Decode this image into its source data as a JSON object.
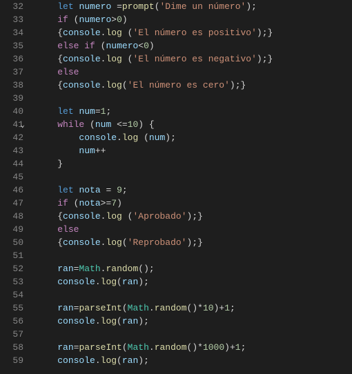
{
  "lines": [
    {
      "num": "32",
      "tokens": [
        [
          "    ",
          ""
        ],
        [
          "let",
          "kw"
        ],
        [
          " ",
          ""
        ],
        [
          "numero",
          "var"
        ],
        [
          " ",
          ""
        ],
        [
          "=",
          "op"
        ],
        [
          "prompt",
          "fn"
        ],
        [
          "(",
          "pun"
        ],
        [
          "'Dime un número'",
          "str"
        ],
        [
          ")",
          "pun"
        ],
        [
          ";",
          "pun"
        ]
      ]
    },
    {
      "num": "33",
      "tokens": [
        [
          "    ",
          ""
        ],
        [
          "if",
          "kw2"
        ],
        [
          " ",
          ""
        ],
        [
          "(",
          "pun"
        ],
        [
          "numero",
          "var"
        ],
        [
          ">",
          "op"
        ],
        [
          "0",
          "num"
        ],
        [
          ")",
          "pun"
        ]
      ]
    },
    {
      "num": "34",
      "tokens": [
        [
          "    ",
          ""
        ],
        [
          "{",
          "pun"
        ],
        [
          "console",
          "var"
        ],
        [
          ".",
          "pun"
        ],
        [
          "log",
          "fn"
        ],
        [
          " ",
          ""
        ],
        [
          "(",
          "pun"
        ],
        [
          "'El número es positivo'",
          "str"
        ],
        [
          ")",
          "pun"
        ],
        [
          ";",
          "pun"
        ],
        [
          "}",
          "pun"
        ]
      ]
    },
    {
      "num": "35",
      "tokens": [
        [
          "    ",
          ""
        ],
        [
          "else",
          "kw2"
        ],
        [
          " ",
          ""
        ],
        [
          "if",
          "kw2"
        ],
        [
          " ",
          ""
        ],
        [
          "(",
          "pun"
        ],
        [
          "numero",
          "var"
        ],
        [
          "<",
          "op"
        ],
        [
          "0",
          "num"
        ],
        [
          ")",
          "pun"
        ]
      ]
    },
    {
      "num": "36",
      "tokens": [
        [
          "    ",
          ""
        ],
        [
          "{",
          "pun"
        ],
        [
          "console",
          "var"
        ],
        [
          ".",
          "pun"
        ],
        [
          "log",
          "fn"
        ],
        [
          " ",
          ""
        ],
        [
          "(",
          "pun"
        ],
        [
          "'El número es negativo'",
          "str"
        ],
        [
          ")",
          "pun"
        ],
        [
          ";",
          "pun"
        ],
        [
          "}",
          "pun"
        ]
      ]
    },
    {
      "num": "37",
      "tokens": [
        [
          "    ",
          ""
        ],
        [
          "else",
          "kw2"
        ]
      ]
    },
    {
      "num": "38",
      "tokens": [
        [
          "    ",
          ""
        ],
        [
          "{",
          "pun"
        ],
        [
          "console",
          "var"
        ],
        [
          ".",
          "pun"
        ],
        [
          "log",
          "fn"
        ],
        [
          "(",
          "pun"
        ],
        [
          "'El número es cero'",
          "str"
        ],
        [
          ")",
          "pun"
        ],
        [
          ";",
          "pun"
        ],
        [
          "}",
          "pun"
        ]
      ]
    },
    {
      "num": "39",
      "tokens": [
        [
          "",
          ""
        ]
      ]
    },
    {
      "num": "40",
      "tokens": [
        [
          "    ",
          ""
        ],
        [
          "let",
          "kw"
        ],
        [
          " ",
          ""
        ],
        [
          "num",
          "var"
        ],
        [
          "=",
          "op"
        ],
        [
          "1",
          "num"
        ],
        [
          ";",
          "pun"
        ]
      ]
    },
    {
      "num": "41",
      "fold": true,
      "tokens": [
        [
          "    ",
          ""
        ],
        [
          "while",
          "kw2"
        ],
        [
          " ",
          ""
        ],
        [
          "(",
          "pun"
        ],
        [
          "num",
          "var"
        ],
        [
          " ",
          ""
        ],
        [
          "<=",
          "op"
        ],
        [
          "10",
          "num"
        ],
        [
          ")",
          "pun"
        ],
        [
          " ",
          ""
        ],
        [
          "{",
          "pun"
        ]
      ]
    },
    {
      "num": "42",
      "tokens": [
        [
          "        ",
          ""
        ],
        [
          "console",
          "var"
        ],
        [
          ".",
          "pun"
        ],
        [
          "log",
          "fn"
        ],
        [
          " ",
          ""
        ],
        [
          "(",
          "pun"
        ],
        [
          "num",
          "var"
        ],
        [
          ")",
          "pun"
        ],
        [
          ";",
          "pun"
        ]
      ]
    },
    {
      "num": "43",
      "tokens": [
        [
          "        ",
          ""
        ],
        [
          "num",
          "var"
        ],
        [
          "++",
          "op"
        ]
      ]
    },
    {
      "num": "44",
      "tokens": [
        [
          "    ",
          ""
        ],
        [
          "}",
          "pun"
        ]
      ]
    },
    {
      "num": "45",
      "tokens": [
        [
          "",
          ""
        ]
      ]
    },
    {
      "num": "46",
      "tokens": [
        [
          "    ",
          ""
        ],
        [
          "let",
          "kw"
        ],
        [
          " ",
          ""
        ],
        [
          "nota",
          "var"
        ],
        [
          " ",
          ""
        ],
        [
          "=",
          "op"
        ],
        [
          " ",
          ""
        ],
        [
          "9",
          "num"
        ],
        [
          ";",
          "pun"
        ]
      ]
    },
    {
      "num": "47",
      "tokens": [
        [
          "    ",
          ""
        ],
        [
          "if",
          "kw2"
        ],
        [
          " ",
          ""
        ],
        [
          "(",
          "pun"
        ],
        [
          "nota",
          "var"
        ],
        [
          ">=",
          "op"
        ],
        [
          "7",
          "num"
        ],
        [
          ")",
          "pun"
        ]
      ]
    },
    {
      "num": "48",
      "tokens": [
        [
          "    ",
          ""
        ],
        [
          "{",
          "pun"
        ],
        [
          "console",
          "var"
        ],
        [
          ".",
          "pun"
        ],
        [
          "log",
          "fn"
        ],
        [
          " ",
          ""
        ],
        [
          "(",
          "pun"
        ],
        [
          "'Aprobado'",
          "str"
        ],
        [
          ")",
          "pun"
        ],
        [
          ";",
          "pun"
        ],
        [
          "}",
          "pun"
        ]
      ]
    },
    {
      "num": "49",
      "tokens": [
        [
          "    ",
          ""
        ],
        [
          "else",
          "kw2"
        ]
      ]
    },
    {
      "num": "50",
      "tokens": [
        [
          "    ",
          ""
        ],
        [
          "{",
          "pun"
        ],
        [
          "console",
          "var"
        ],
        [
          ".",
          "pun"
        ],
        [
          "log",
          "fn"
        ],
        [
          "(",
          "pun"
        ],
        [
          "'Reprobado'",
          "str"
        ],
        [
          ")",
          "pun"
        ],
        [
          ";",
          "pun"
        ],
        [
          "}",
          "pun"
        ]
      ]
    },
    {
      "num": "51",
      "tokens": [
        [
          "",
          ""
        ]
      ]
    },
    {
      "num": "52",
      "tokens": [
        [
          "    ",
          ""
        ],
        [
          "ran",
          "var"
        ],
        [
          "=",
          "op"
        ],
        [
          "Math",
          "obj"
        ],
        [
          ".",
          "pun"
        ],
        [
          "random",
          "fn"
        ],
        [
          "(",
          "pun"
        ],
        [
          ")",
          "pun"
        ],
        [
          ";",
          "pun"
        ]
      ]
    },
    {
      "num": "53",
      "tokens": [
        [
          "    ",
          ""
        ],
        [
          "console",
          "var"
        ],
        [
          ".",
          "pun"
        ],
        [
          "log",
          "fn"
        ],
        [
          "(",
          "pun"
        ],
        [
          "ran",
          "var"
        ],
        [
          ")",
          "pun"
        ],
        [
          ";",
          "pun"
        ]
      ]
    },
    {
      "num": "54",
      "tokens": [
        [
          "",
          ""
        ]
      ]
    },
    {
      "num": "55",
      "tokens": [
        [
          "    ",
          ""
        ],
        [
          "ran",
          "var"
        ],
        [
          "=",
          "op"
        ],
        [
          "parseInt",
          "fn"
        ],
        [
          "(",
          "pun"
        ],
        [
          "Math",
          "obj"
        ],
        [
          ".",
          "pun"
        ],
        [
          "random",
          "fn"
        ],
        [
          "(",
          "pun"
        ],
        [
          ")",
          "pun"
        ],
        [
          "*",
          "op"
        ],
        [
          "10",
          "num"
        ],
        [
          ")",
          "pun"
        ],
        [
          "+",
          "op"
        ],
        [
          "1",
          "num"
        ],
        [
          ";",
          "pun"
        ]
      ]
    },
    {
      "num": "56",
      "tokens": [
        [
          "    ",
          ""
        ],
        [
          "console",
          "var"
        ],
        [
          ".",
          "pun"
        ],
        [
          "log",
          "fn"
        ],
        [
          "(",
          "pun"
        ],
        [
          "ran",
          "var"
        ],
        [
          ")",
          "pun"
        ],
        [
          ";",
          "pun"
        ]
      ]
    },
    {
      "num": "57",
      "tokens": [
        [
          "",
          ""
        ]
      ]
    },
    {
      "num": "58",
      "tokens": [
        [
          "    ",
          ""
        ],
        [
          "ran",
          "var"
        ],
        [
          "=",
          "op"
        ],
        [
          "parseInt",
          "fn"
        ],
        [
          "(",
          "pun"
        ],
        [
          "Math",
          "obj"
        ],
        [
          ".",
          "pun"
        ],
        [
          "random",
          "fn"
        ],
        [
          "(",
          "pun"
        ],
        [
          ")",
          "pun"
        ],
        [
          "*",
          "op"
        ],
        [
          "1000",
          "num"
        ],
        [
          ")",
          "pun"
        ],
        [
          "+",
          "op"
        ],
        [
          "1",
          "num"
        ],
        [
          ";",
          "pun"
        ]
      ]
    },
    {
      "num": "59",
      "tokens": [
        [
          "    ",
          ""
        ],
        [
          "console",
          "var"
        ],
        [
          ".",
          "pun"
        ],
        [
          "log",
          "fn"
        ],
        [
          "(",
          "pun"
        ],
        [
          "ran",
          "var"
        ],
        [
          ")",
          "pun"
        ],
        [
          ";",
          "pun"
        ]
      ]
    }
  ]
}
